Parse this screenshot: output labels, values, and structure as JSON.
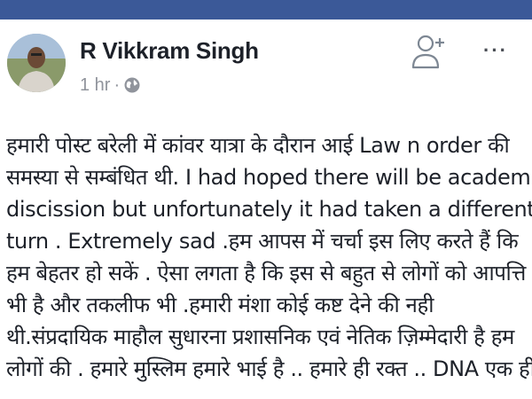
{
  "colors": {
    "topbar": "#3b5998",
    "name": "#1d2129",
    "meta": "#90949c",
    "text": "#1d2129"
  },
  "header": {
    "author_name": "R Vikkram Singh",
    "timestamp": "1 hr",
    "separator": "·",
    "privacy_icon": "globe-icon",
    "add_friend_icon": "add-friend-icon",
    "more_label": "···"
  },
  "post": {
    "lines": [
      "हमारी पोस्ट बरेली में कांवर यात्रा के दौरान आई Law n order की",
      "समस्या से सम्बंधित थी. I had hoped there will be academic",
      "discission but unfortunately it had taken a different",
      "turn . Extremely sad .हम  आपस में चर्चा इस लिए करते हैं कि",
      "हम बेहतर हो सकें . ऐसा लगता है कि इस से बहुत से लोगों को आपत्ति",
      "भी है और तकलीफ भी .हमारी  मंशा कोई कष्ट देने की नही",
      "थी.संप्रदायिक माहौल सुधारना प्रशासनिक एवं नेतिक ज़िम्मेदारी है हम",
      "लोगों की . हमारे मुस्लिम हमारे भाई है .. हमारे ही रक्त .. DNA  एक ही"
    ]
  }
}
